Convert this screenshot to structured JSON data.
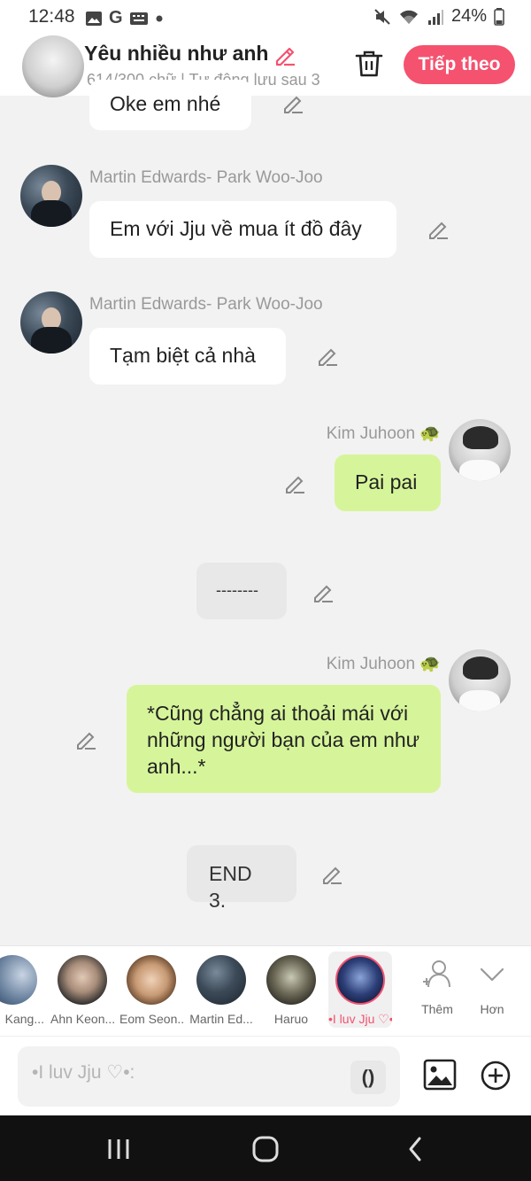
{
  "status": {
    "time": "12:48",
    "battery": "24%"
  },
  "header": {
    "title": "3. Yêu nhiều như anh",
    "subtitle": "614/300 chữ | Tự động lưu sau 3",
    "next_label": "Tiếp theo"
  },
  "messages": [
    {
      "text": "Oke em nhé"
    },
    {
      "sender": "Martin Edwards- Park Woo-Joo",
      "text": "Em với Jju về mua ít đồ đây"
    },
    {
      "sender": "Martin Edwards- Park Woo-Joo",
      "text": "Tạm biệt cả nhà"
    },
    {
      "sender": "Kim Juhoon 🐢",
      "text": "Pai pai"
    },
    {
      "text": "--------"
    },
    {
      "sender": "Kim Juhoon 🐢",
      "text": "*Cũng chẳng ai thoải mái với những người bạn của em như anh...*"
    },
    {
      "text": "END 3."
    }
  ],
  "characters": [
    {
      "label": "Kang..."
    },
    {
      "label": "Ahn Keon..."
    },
    {
      "label": "Eom Seon..."
    },
    {
      "label": "Martin Ed..."
    },
    {
      "label": "Haruo"
    },
    {
      "label": "•I luv Jju ♡•",
      "selected": true
    }
  ],
  "actions": {
    "add_label": "Thêm",
    "more_label": "Hơn"
  },
  "input": {
    "placeholder": "•I luv Jju ♡•:",
    "paren": "()"
  },
  "colors": {
    "accent": "#f4526f",
    "my_bubble": "#d6f59a",
    "other_bubble": "#ffffff",
    "background": "#f2f2f2"
  }
}
